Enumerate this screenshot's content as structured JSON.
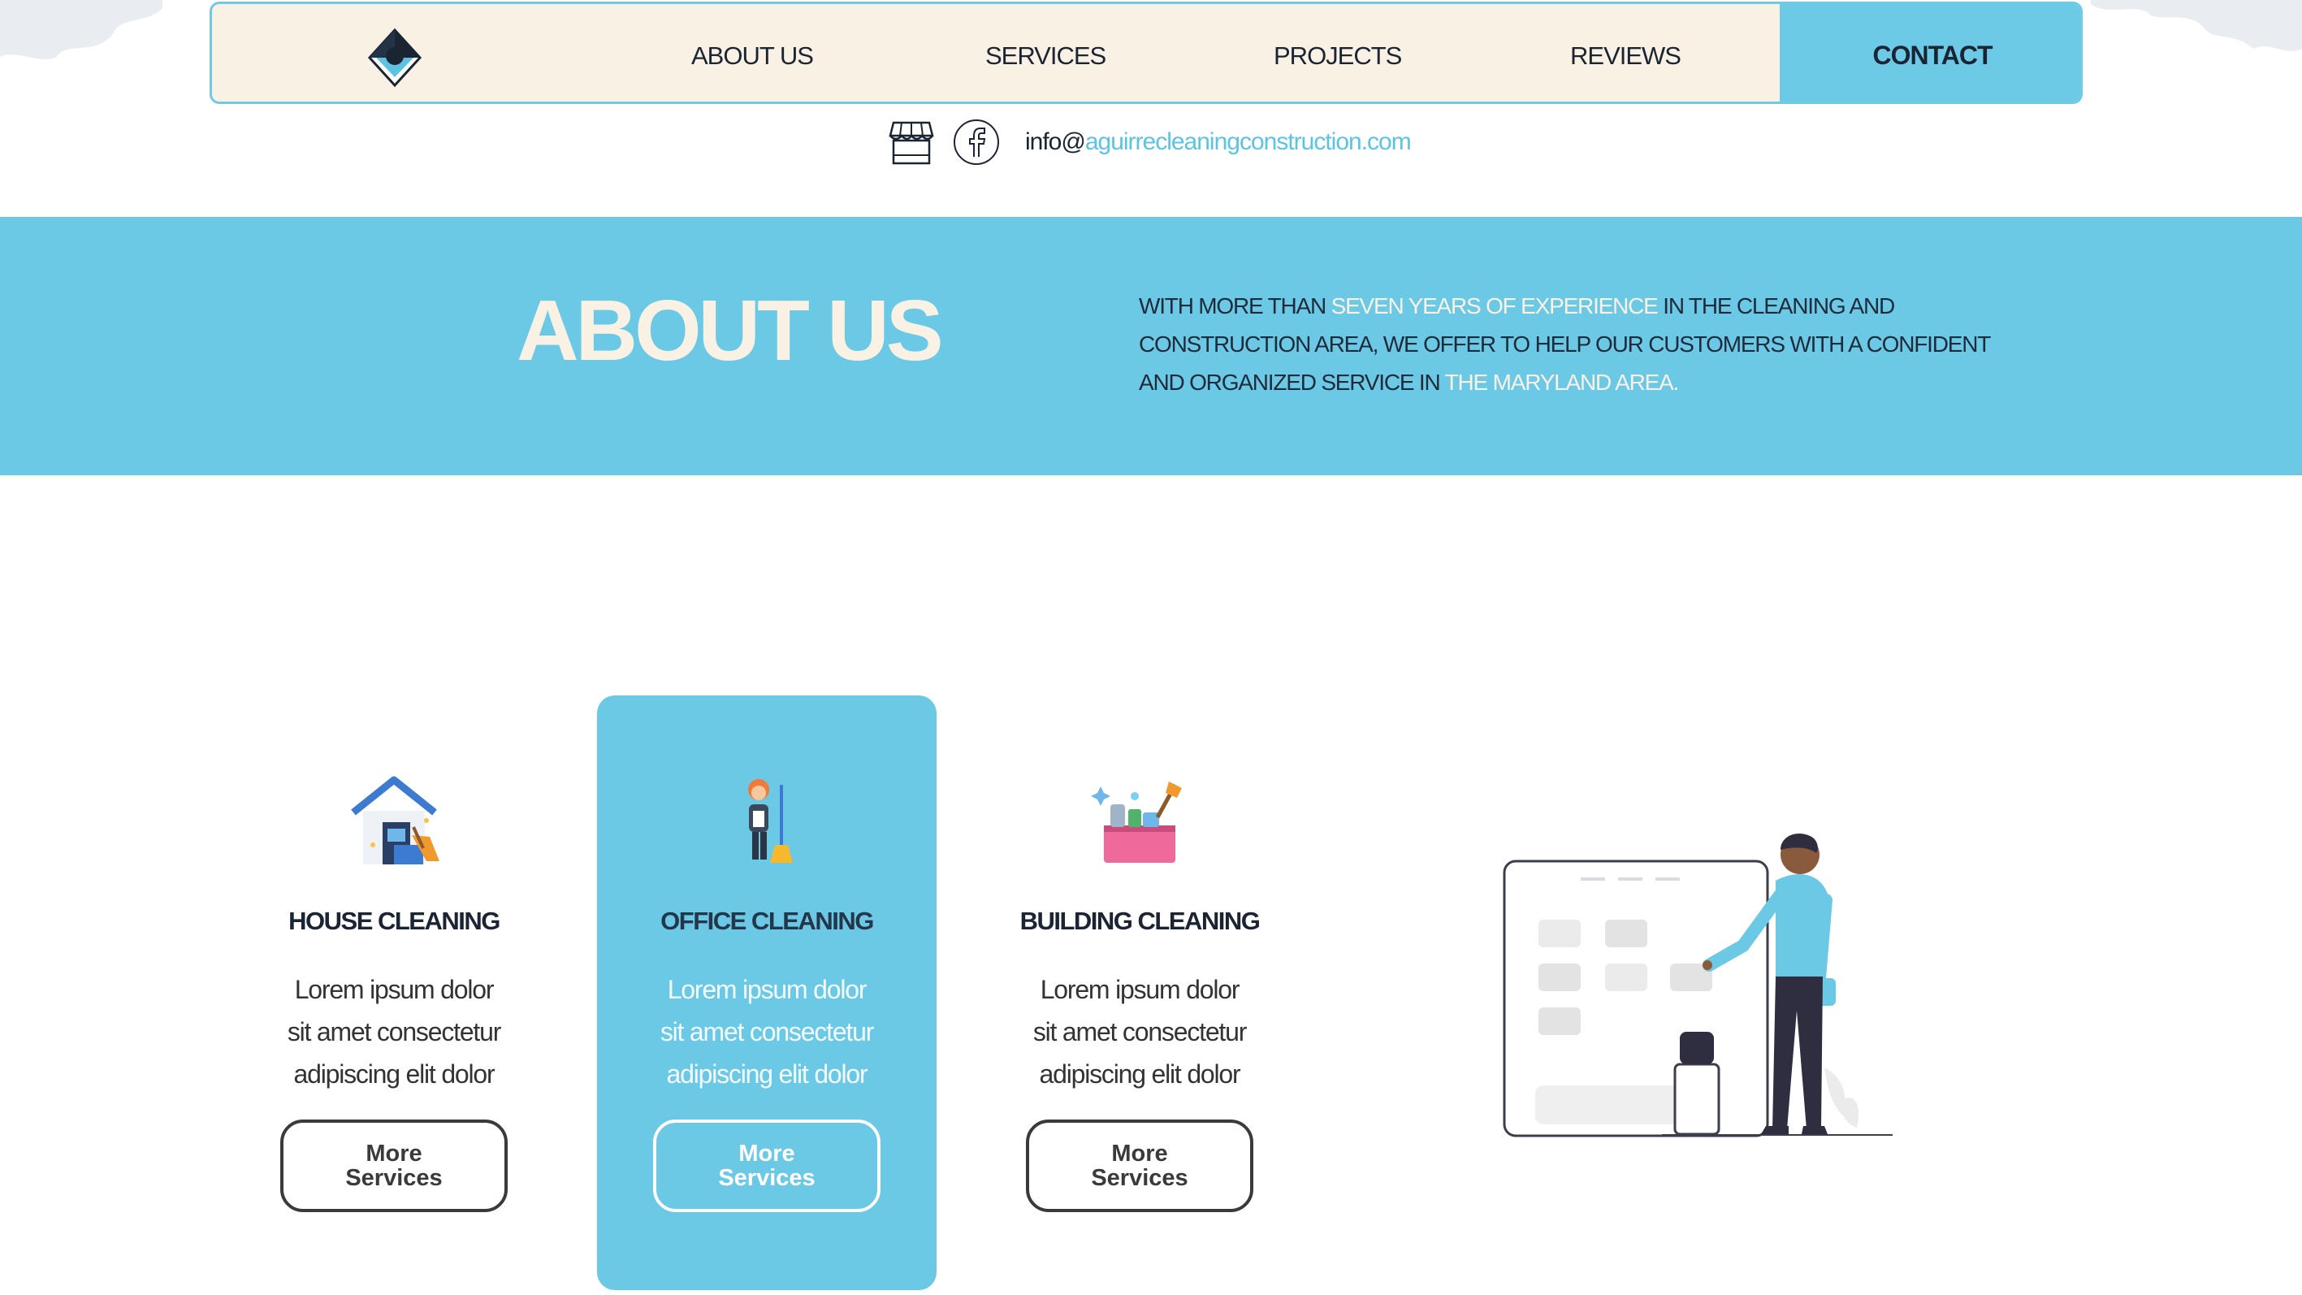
{
  "nav": {
    "links": [
      "ABOUT US",
      "SERVICES",
      "PROJECTS",
      "REVIEWS"
    ],
    "contact": "CONTACT"
  },
  "contact_row": {
    "email_user": "info@",
    "email_domain": "aguirrecleaningconstruction.com"
  },
  "about": {
    "title": "ABOUT US",
    "text_parts": [
      "WITH MORE THAN ",
      "SEVEN YEARS OF EXPERIENCE",
      " IN THE CLEANING AND CONSTRUCTION AREA, WE OFFER TO HELP OUR CUSTOMERS WITH A CONFIDENT AND ORGANIZED SERVICE IN ",
      "THE MARYLAND AREA."
    ]
  },
  "services": [
    {
      "title": "HOUSE CLEANING",
      "desc_lines": [
        "Lorem ipsum dolor",
        "sit amet consectetur",
        "adipiscing elit dolor"
      ],
      "button_line1": "More",
      "button_line2": "Services"
    },
    {
      "title": "OFFICE CLEANING",
      "desc_lines": [
        "Lorem ipsum dolor",
        "sit amet consectetur",
        "adipiscing elit dolor"
      ],
      "button_line1": "More",
      "button_line2": "Services"
    },
    {
      "title": "BUILDING CLEANING",
      "desc_lines": [
        "Lorem ipsum dolor",
        "sit amet consectetur",
        "adipiscing elit dolor"
      ],
      "button_line1": "More",
      "button_line2": "Services"
    }
  ],
  "colors": {
    "accent_blue": "#6cc9e5",
    "cream": "#f9f1e3",
    "dark_text": "#1b2433"
  },
  "icons": [
    "logo-diamond-icon",
    "store-icon",
    "facebook-icon",
    "house-cleaning-icon",
    "office-cleaning-icon",
    "building-cleaning-icon"
  ]
}
